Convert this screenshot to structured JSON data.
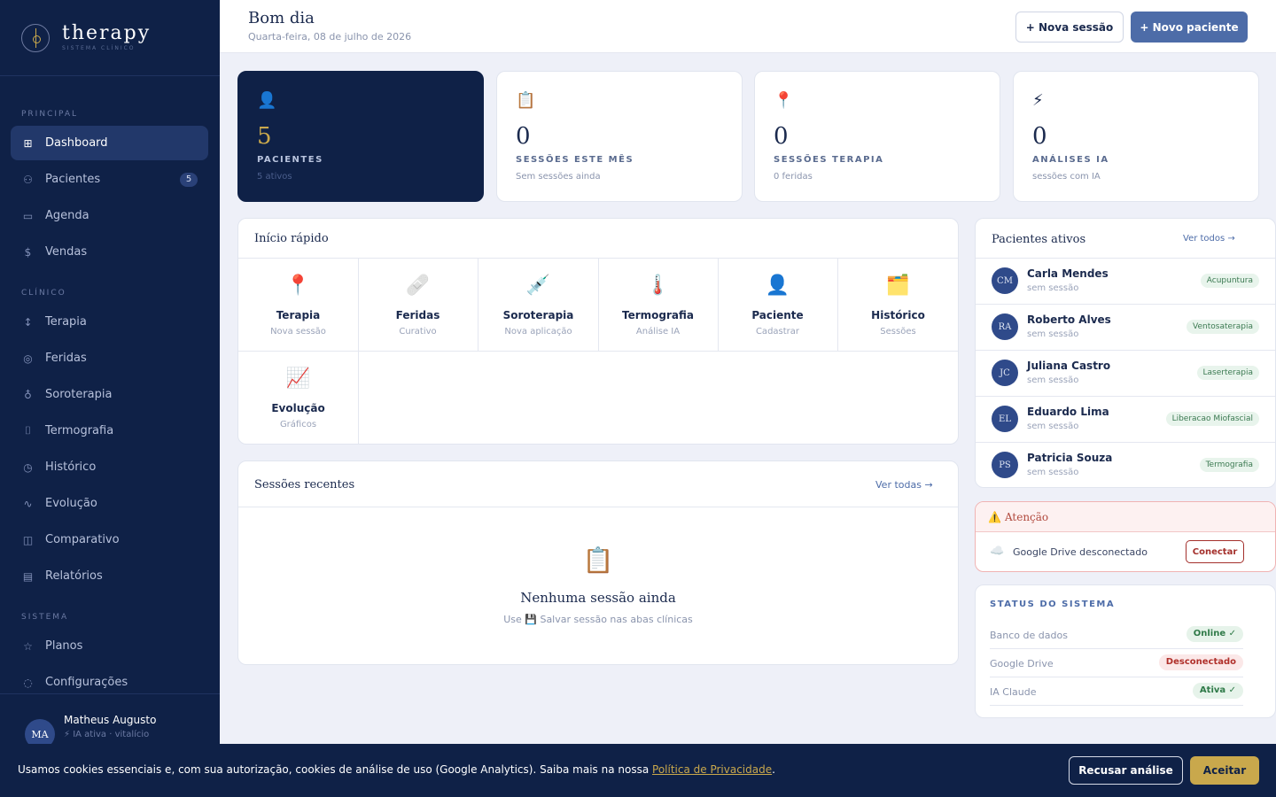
{
  "brand": {
    "name": "therapy",
    "subtitle": "SISTEMA CLÍNICO"
  },
  "sidebar": {
    "sections": [
      "PRINCIPAL",
      "CLÍNICO",
      "SISTEMA"
    ],
    "items": [
      {
        "label": "Dashboard",
        "icon": "grid-icon",
        "glyph": "⊞"
      },
      {
        "label": "Pacientes",
        "icon": "users-icon",
        "glyph": "⚇",
        "badge": "5"
      },
      {
        "label": "Agenda",
        "icon": "calendar-icon",
        "glyph": "▭"
      },
      {
        "label": "Vendas",
        "icon": "dollar-icon",
        "glyph": "$"
      },
      {
        "label": "Terapia",
        "icon": "needle-icon",
        "glyph": "↕"
      },
      {
        "label": "Feridas",
        "icon": "target-icon",
        "glyph": "◎"
      },
      {
        "label": "Soroterapia",
        "icon": "flask-icon",
        "glyph": "♁"
      },
      {
        "label": "Termografia",
        "icon": "thermometer-icon",
        "glyph": "⌷"
      },
      {
        "label": "Histórico",
        "icon": "clock-icon",
        "glyph": "◷"
      },
      {
        "label": "Evolução",
        "icon": "activity-icon",
        "glyph": "∿"
      },
      {
        "label": "Comparativo",
        "icon": "columns-icon",
        "glyph": "◫"
      },
      {
        "label": "Relatórios",
        "icon": "file-icon",
        "glyph": "▤"
      },
      {
        "label": "Planos",
        "icon": "star-icon",
        "glyph": "☆"
      },
      {
        "label": "Configurações",
        "icon": "settings-icon",
        "glyph": "◌"
      }
    ]
  },
  "user": {
    "initials": "MA",
    "name": "Matheus Augusto",
    "status": "⚡ IA ativa · vitalício"
  },
  "header": {
    "greeting": "Bom dia",
    "date": "Quarta-feira, 08 de julho de 2026",
    "new_session": "+ Nova sessão",
    "new_patient": "+ Novo paciente"
  },
  "stats": [
    {
      "icon": "👤",
      "value": "5",
      "label": "PACIENTES",
      "sub": "5 ativos"
    },
    {
      "icon": "📋",
      "value": "0",
      "label": "SESSÕES ESTE MÊS",
      "sub": "Sem sessões ainda"
    },
    {
      "icon": "📍",
      "value": "0",
      "label": "SESSÕES TERAPIA",
      "sub": "0 feridas"
    },
    {
      "icon": "⚡",
      "value": "0",
      "label": "ANÁLISES IA",
      "sub": "sessões com IA"
    }
  ],
  "quick_start": {
    "title": "Início rápido",
    "items": [
      {
        "icon": "📍",
        "title": "Terapia",
        "sub": "Nova sessão"
      },
      {
        "icon": "🩹",
        "title": "Feridas",
        "sub": "Curativo"
      },
      {
        "icon": "💉",
        "title": "Soroterapia",
        "sub": "Nova aplicação"
      },
      {
        "icon": "🌡️",
        "title": "Termografia",
        "sub": "Análise IA"
      },
      {
        "icon": "👤",
        "title": "Paciente",
        "sub": "Cadastrar"
      },
      {
        "icon": "🗂️",
        "title": "Histórico",
        "sub": "Sessões"
      },
      {
        "icon": "📈",
        "title": "Evolução",
        "sub": "Gráficos"
      }
    ]
  },
  "recent_sessions": {
    "title": "Sessões recentes",
    "link": "Ver todas →",
    "empty_icon": "📋",
    "empty_title": "Nenhuma sessão ainda",
    "empty_sub": "Use 💾 Salvar sessão nas abas clínicas"
  },
  "active_patients": {
    "title": "Pacientes ativos",
    "link": "Ver todos →",
    "items": [
      {
        "initials": "CM",
        "name": "Carla Mendes",
        "sub": "sem sessão",
        "tag": "Acupuntura"
      },
      {
        "initials": "RA",
        "name": "Roberto Alves",
        "sub": "sem sessão",
        "tag": "Ventosaterapia"
      },
      {
        "initials": "JC",
        "name": "Juliana Castro",
        "sub": "sem sessão",
        "tag": "Laserterapia"
      },
      {
        "initials": "EL",
        "name": "Eduardo Lima",
        "sub": "sem sessão",
        "tag": "Liberacao Miofascial"
      },
      {
        "initials": "PS",
        "name": "Patricia Souza",
        "sub": "sem sessão",
        "tag": "Termografia"
      }
    ]
  },
  "alert": {
    "title": "Atenção",
    "icon": "⚠️",
    "cloud": "☁️",
    "message": "Google Drive desconectado",
    "button": "Conectar"
  },
  "system_status": {
    "title": "STATUS DO SISTEMA",
    "rows": [
      {
        "label": "Banco de dados",
        "status": "Online ✓",
        "ok": true
      },
      {
        "label": "Google Drive",
        "status": "Desconectado",
        "ok": false
      },
      {
        "label": "IA Claude",
        "status": "Ativa ✓",
        "ok": true
      }
    ]
  },
  "cookie": {
    "text": "Usamos cookies essenciais e, com sua autorização, cookies de análise de uso (Google Analytics). Saiba mais na nossa ",
    "link": "Política de Privacidade",
    "end": ".",
    "reject": "Recusar análise",
    "accept": "Aceitar"
  }
}
